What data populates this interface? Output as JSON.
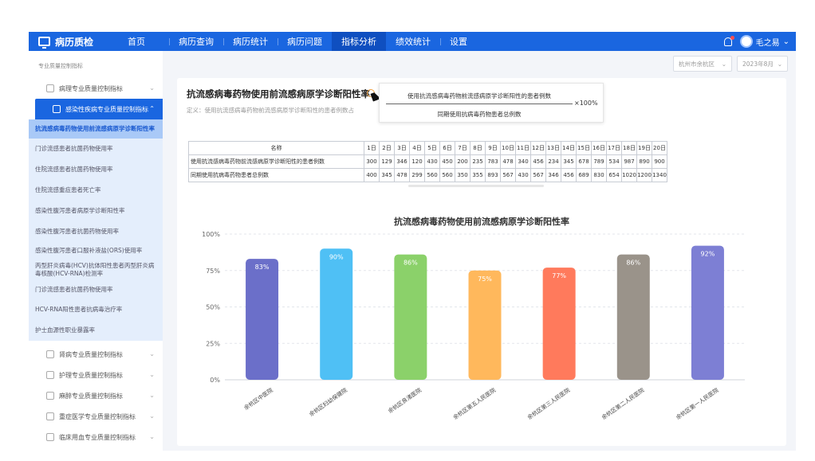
{
  "topbar": {
    "app_title": "病历质检",
    "nav": [
      "首页",
      "病历查询",
      "病历统计",
      "病历问题",
      "指标分析",
      "绩效统计",
      "设置"
    ],
    "active_nav": "指标分析",
    "user_name": "毛之易",
    "accent": "#1a66e0"
  },
  "sidebar": {
    "breadcrumb": "专业质量控制指标",
    "group_top": "病理专业质量控制指标",
    "group_open": "感染性疾病专业质量控制指标",
    "subitems": [
      "抗流感病毒药物使用前流感病原学诊断阳性率",
      "门诊流感患者抗菌药物使用率",
      "住院流感患者抗菌药物使用率",
      "住院流感重症患者死亡率",
      "感染性腹泻患者病原学诊断阳性率",
      "感染性腹泻患者抗菌药物使用率",
      "感染性腹泻患者口服补液盐(ORS)使用率",
      "丙型肝炎病毒(HCV)抗体阳性患者丙型肝炎病毒核酸(HCV-RNA)检测率",
      "门诊流感患者抗菌药物使用率",
      "HCV-RNA阳性患者抗病毒治疗率",
      "护士血源性职业暴露率"
    ],
    "groups_bottom": [
      "肾病专业质量控制指标",
      "护理专业质量控制指标",
      "麻醉专业质量控制指标",
      "重症医学专业质量控制指标",
      "临床用血专业质量控制指标"
    ]
  },
  "filters": {
    "region": "杭州市余杭区",
    "month": "2023年8月"
  },
  "main": {
    "title": "抗流感病毒药物使用前流感病原学诊断阳性率",
    "definition": "定义：使用抗流感病毒药物前流感病原学诊断阳性的患者例数占",
    "tooltip": {
      "numerator": "使用抗流感病毒药物前流感病原学诊断阳性的患者例数",
      "denominator": "同期使用抗病毒药物患者总例数",
      "multiplier": "×100%"
    },
    "table": {
      "header_name": "名称",
      "days": [
        "1日",
        "2日",
        "3日",
        "4日",
        "5日",
        "6日",
        "7日",
        "8日",
        "9日",
        "10日",
        "11日",
        "12日",
        "13日",
        "14日",
        "15日",
        "16日",
        "17日",
        "18日",
        "19日",
        "20日"
      ],
      "rows": [
        {
          "name": "使用抗流感病毒药物前流感病原学诊断阳性的患者例数",
          "values": [
            "300",
            "129",
            "346",
            "120",
            "430",
            "450",
            "200",
            "235",
            "783",
            "478",
            "340",
            "456",
            "234",
            "345",
            "678",
            "789",
            "534",
            "987",
            "890",
            "900"
          ]
        },
        {
          "name": "同期使用抗病毒药物患者总例数",
          "values": [
            "400",
            "345",
            "478",
            "299",
            "560",
            "560",
            "350",
            "355",
            "893",
            "567",
            "430",
            "567",
            "346",
            "456",
            "689",
            "830",
            "654",
            "1020",
            "1200",
            "1340"
          ]
        }
      ]
    }
  },
  "chart_data": {
    "type": "bar",
    "title": "抗流感病毒药物使用前流感病原学诊断阳性率",
    "categories": [
      "余杭区中医院",
      "余杭区妇幼保健院",
      "余杭区良渚医院",
      "余杭区第五人民医院",
      "余杭区第三人民医院",
      "余杭区第二人民医院",
      "余杭区第一人民医院"
    ],
    "values": [
      83,
      90,
      86,
      75,
      77,
      86,
      92
    ],
    "value_labels": [
      "83%",
      "90%",
      "86%",
      "75%",
      "77%",
      "86%",
      "92%"
    ],
    "colors": [
      "#6b6fc9",
      "#4fc0f5",
      "#8bd16a",
      "#ffb85c",
      "#ff7a5c",
      "#9a938a",
      "#7d7fd4"
    ],
    "ylim": [
      0,
      100
    ],
    "yticks": [
      "0%",
      "25%",
      "50%",
      "75%",
      "100%"
    ],
    "grid": true
  }
}
